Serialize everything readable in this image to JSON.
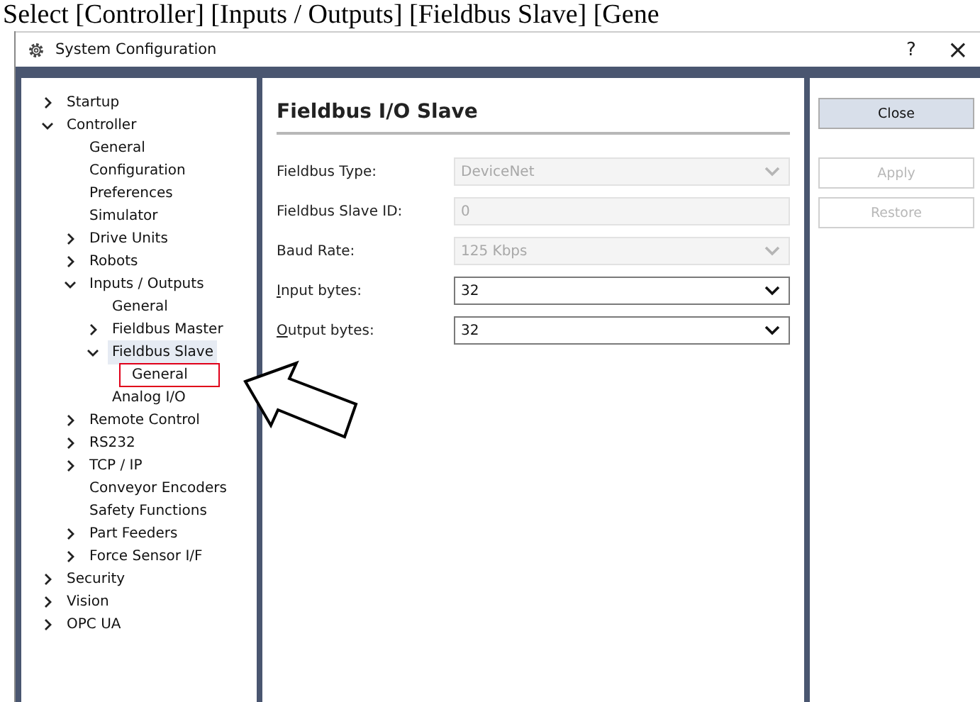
{
  "caption": "Select [Controller] [Inputs / Outputs] [Fieldbus Slave] [Gene",
  "window": {
    "title": "System Configuration",
    "help": "?",
    "close": "×"
  },
  "tree": [
    {
      "label": "Startup",
      "kind": "group",
      "expanded": false,
      "selected": false,
      "callout": false
    },
    {
      "label": "Controller",
      "kind": "group",
      "expanded": true,
      "selected": false,
      "callout": false,
      "children": [
        {
          "label": "General",
          "kind": "leaf",
          "selected": false,
          "callout": false
        },
        {
          "label": "Configuration",
          "kind": "leaf",
          "selected": false,
          "callout": false
        },
        {
          "label": "Preferences",
          "kind": "leaf",
          "selected": false,
          "callout": false
        },
        {
          "label": "Simulator",
          "kind": "leaf",
          "selected": false,
          "callout": false
        },
        {
          "label": "Drive Units",
          "kind": "group",
          "expanded": false,
          "selected": false,
          "callout": false
        },
        {
          "label": "Robots",
          "kind": "group",
          "expanded": false,
          "selected": false,
          "callout": false
        },
        {
          "label": "Inputs / Outputs",
          "kind": "group",
          "expanded": true,
          "selected": false,
          "callout": false,
          "children": [
            {
              "label": "General",
              "kind": "leaf",
              "selected": false,
              "callout": false
            },
            {
              "label": "Fieldbus Master",
              "kind": "group",
              "expanded": false,
              "selected": false,
              "callout": false
            },
            {
              "label": "Fieldbus Slave",
              "kind": "group",
              "expanded": true,
              "selected": true,
              "callout": false,
              "children": [
                {
                  "label": "General",
                  "kind": "leaf",
                  "selected": false,
                  "callout": true
                }
              ]
            },
            {
              "label": "Analog I/O",
              "kind": "leaf",
              "selected": false,
              "callout": false
            }
          ]
        },
        {
          "label": "Remote Control",
          "kind": "group",
          "expanded": false,
          "selected": false,
          "callout": false
        },
        {
          "label": "RS232",
          "kind": "group",
          "expanded": false,
          "selected": false,
          "callout": false
        },
        {
          "label": "TCP / IP",
          "kind": "group",
          "expanded": false,
          "selected": false,
          "callout": false
        },
        {
          "label": "Conveyor Encoders",
          "kind": "leaf",
          "selected": false,
          "callout": false
        },
        {
          "label": "Safety Functions",
          "kind": "leaf",
          "selected": false,
          "callout": false
        },
        {
          "label": "Part Feeders",
          "kind": "group",
          "expanded": false,
          "selected": false,
          "callout": false
        },
        {
          "label": "Force Sensor I/F",
          "kind": "group",
          "expanded": false,
          "selected": false,
          "callout": false
        }
      ]
    },
    {
      "label": "Security",
      "kind": "group",
      "expanded": false,
      "selected": false,
      "callout": false
    },
    {
      "label": "Vision",
      "kind": "group",
      "expanded": false,
      "selected": false,
      "callout": false
    },
    {
      "label": "OPC UA",
      "kind": "group",
      "expanded": false,
      "selected": false,
      "callout": false
    }
  ],
  "panel": {
    "title": "Fieldbus I/O Slave",
    "fields": [
      {
        "label": "Fieldbus Type:",
        "kind": "dropdown",
        "value": "DeviceNet",
        "disabled": true,
        "access_key_underlined": false
      },
      {
        "label": "Fieldbus Slave ID:",
        "kind": "text",
        "value": "0",
        "disabled": true,
        "access_key_underlined": false
      },
      {
        "label": "Baud Rate:",
        "kind": "dropdown",
        "value": "125 Kbps",
        "disabled": true,
        "access_key_underlined": false
      },
      {
        "label": "Input bytes:",
        "kind": "dropdown",
        "value": "32",
        "disabled": false,
        "access_key_underlined": true
      },
      {
        "label": "Output bytes:",
        "kind": "dropdown",
        "value": "32",
        "disabled": false,
        "access_key_underlined": true
      }
    ]
  },
  "buttons": [
    {
      "label": "Close",
      "disabled": false
    },
    {
      "label": "Apply",
      "disabled": true
    },
    {
      "label": "Restore",
      "disabled": true
    }
  ]
}
